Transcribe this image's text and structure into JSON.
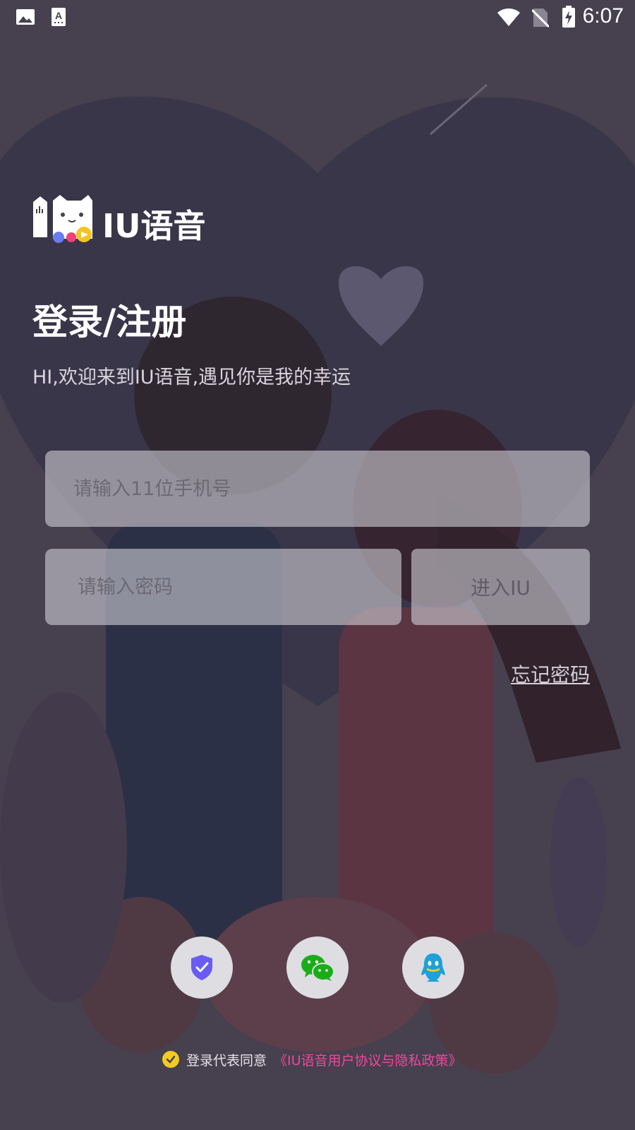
{
  "status_bar": {
    "time": "6:07",
    "icons": [
      "image-icon",
      "keyboard-a-icon",
      "wifi-icon",
      "no-sim-icon",
      "battery-charging-icon"
    ]
  },
  "brand": {
    "name": "IU语音"
  },
  "login": {
    "title": "登录/注册",
    "subtitle": "HI,欢迎来到IU语音,遇见你是我的幸运",
    "phone_placeholder": "请输入11位手机号",
    "password_placeholder": "请输入密码",
    "enter_label": "进入IU",
    "forgot_label": "忘记密码"
  },
  "third_party": [
    "shield-check-icon",
    "wechat-icon",
    "qq-icon"
  ],
  "agreement": {
    "prefix": "登录代表同意",
    "policy": "《IU语音用户协议与隐私政策》"
  },
  "colors": {
    "overlay": "#46404f",
    "accent_pink": "#f1469a",
    "check_yellow": "#f2cb22",
    "shield_purple": "#6a5cf2",
    "wechat_green": "#1aad19",
    "qq_blue": "#1ea0d8"
  }
}
